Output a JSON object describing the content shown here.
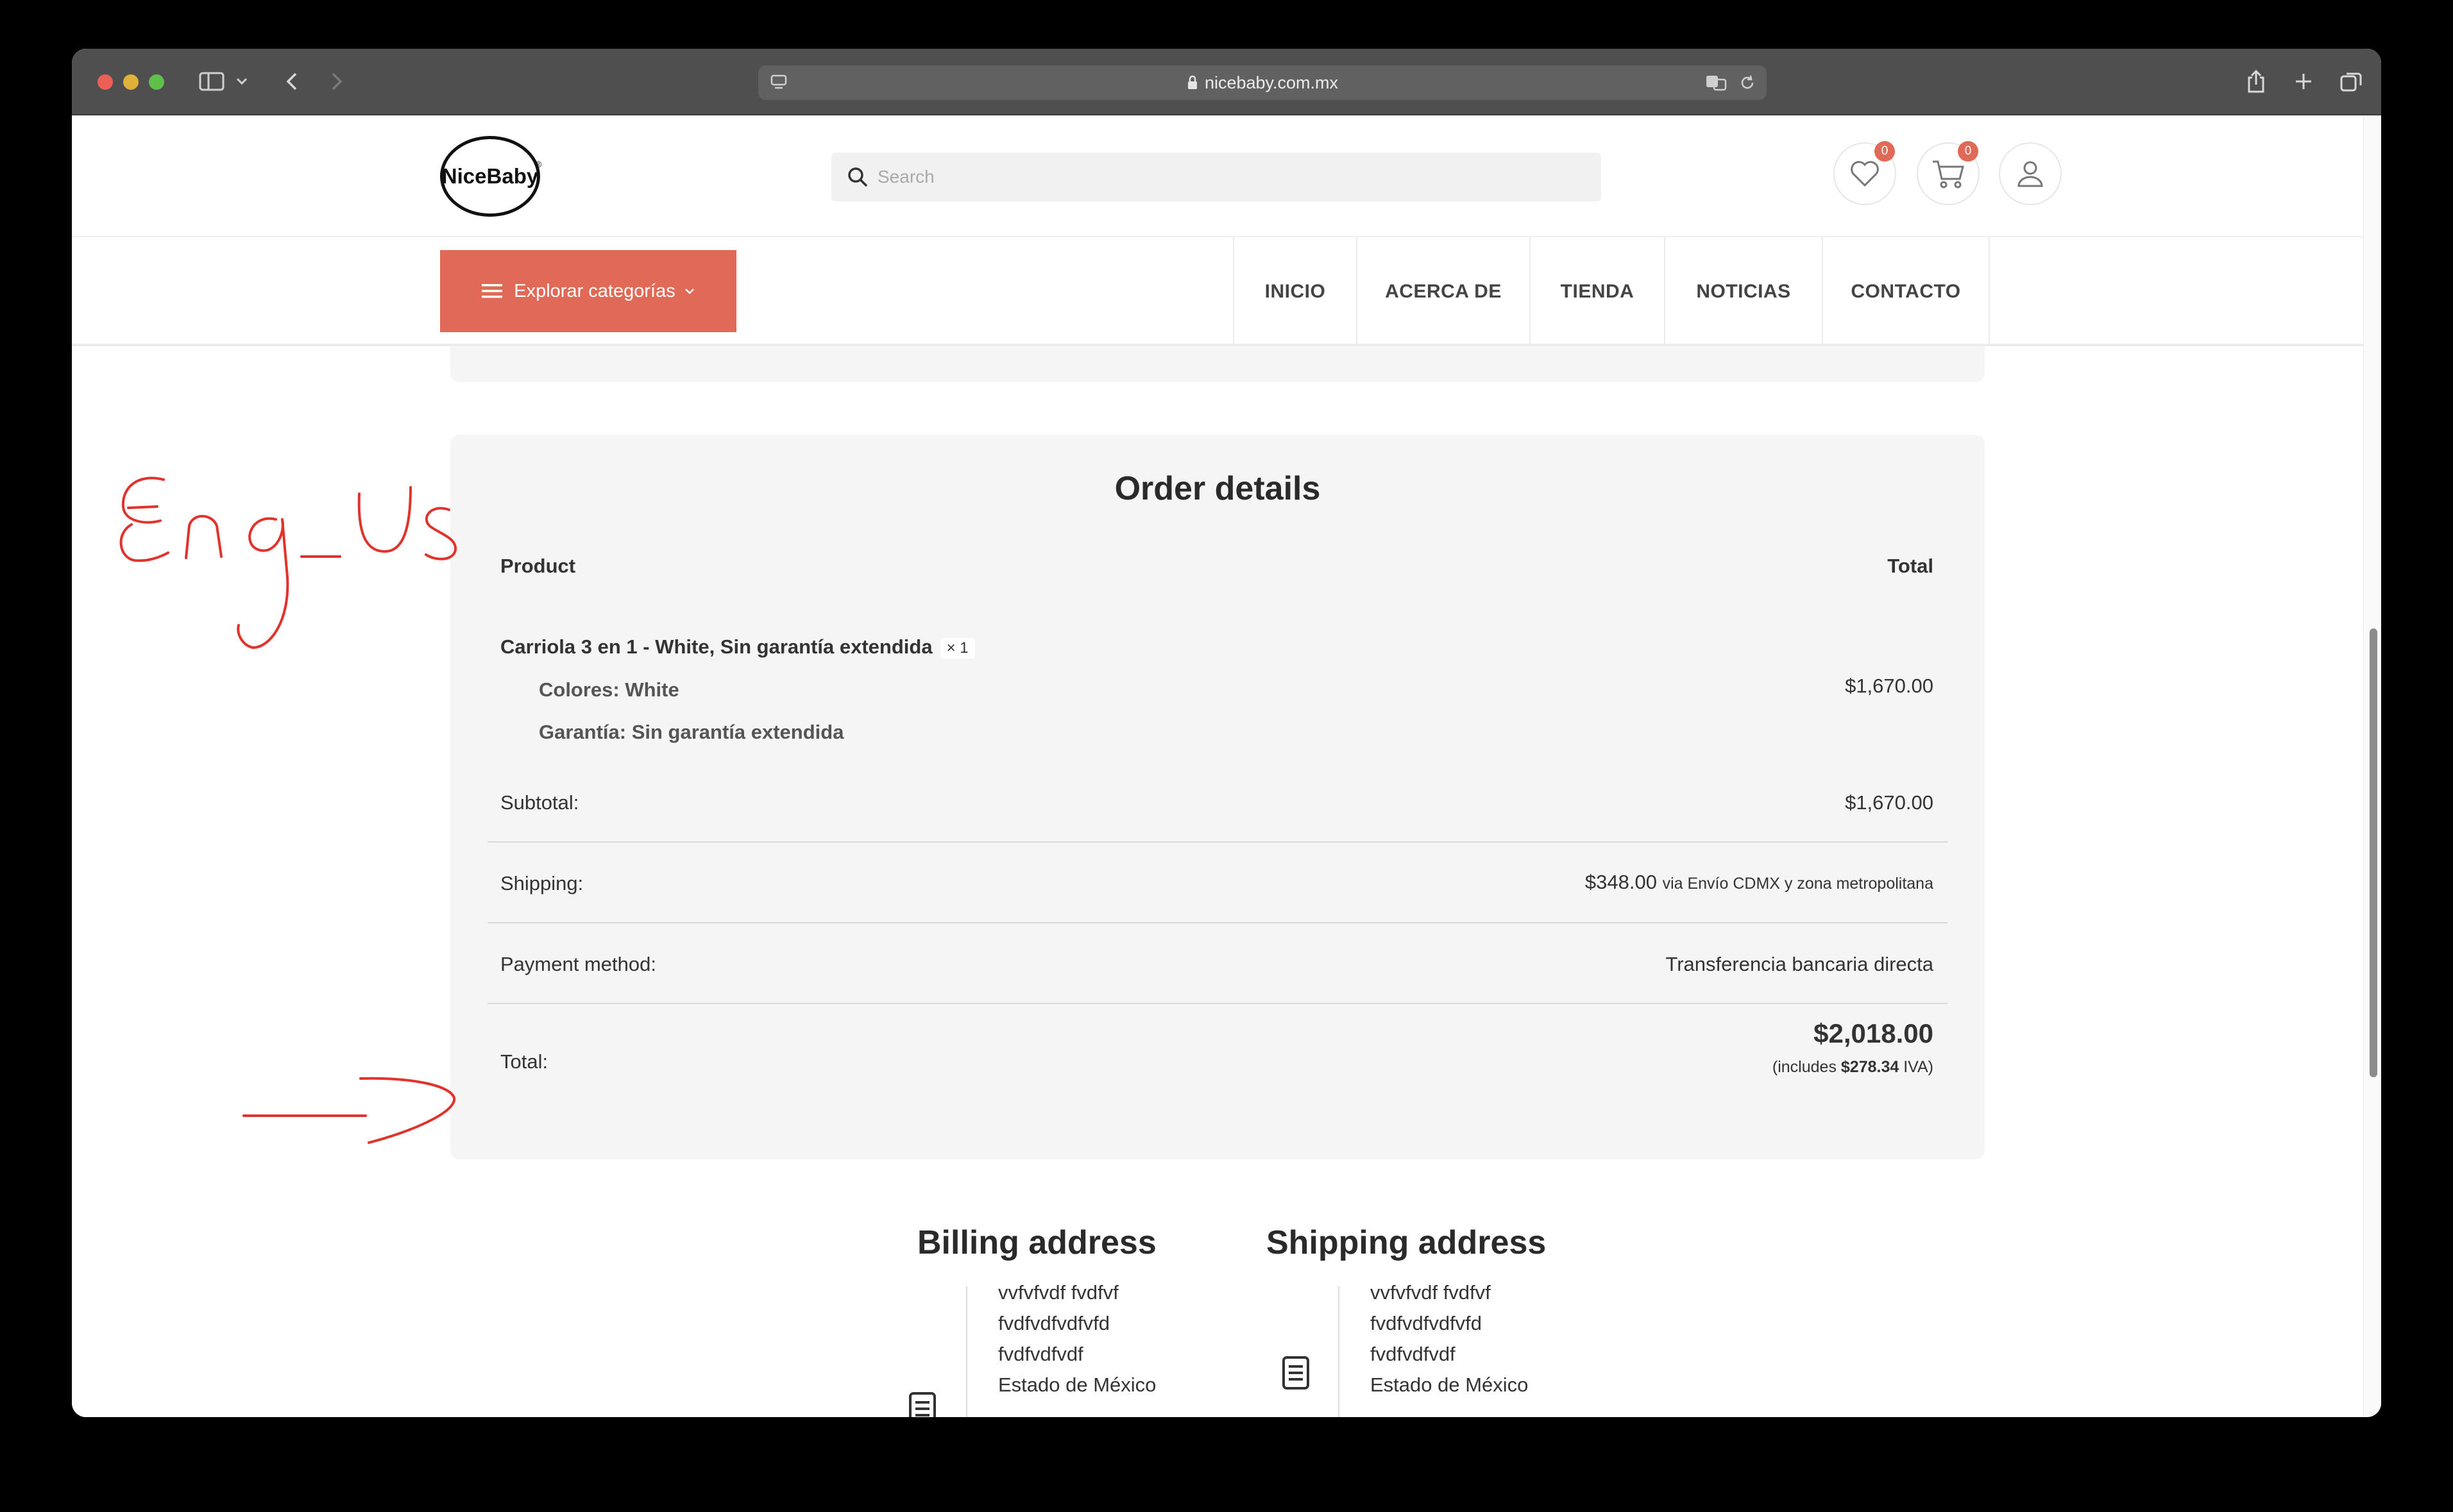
{
  "browser": {
    "url": "nicebaby.com.mx"
  },
  "header": {
    "logo_text": "NiceBaby",
    "logo_reg": "®",
    "search_placeholder": "Search",
    "wishlist_count": "0",
    "cart_count": "0"
  },
  "nav": {
    "categories_label": "Explorar categorías",
    "items": [
      "INICIO",
      "ACERCA DE",
      "TIENDA",
      "NOTICIAS",
      "CONTACTO"
    ]
  },
  "order": {
    "title": "Order details",
    "col_product": "Product",
    "col_total": "Total",
    "item": {
      "name": "Carriola 3 en 1 - White, Sin garantía extendida",
      "qty": "× 1",
      "meta_1": "Colores: White",
      "meta_2": "Garantía: Sin garantía extendida",
      "price": "$1,670.00"
    },
    "subtotal_label": "Subtotal:",
    "subtotal_value": "$1,670.00",
    "shipping_label": "Shipping:",
    "shipping_value": "$348.00",
    "shipping_via": "via Envío CDMX y zona metropolitana",
    "payment_label": "Payment method:",
    "payment_value": "Transferencia bancaria directa",
    "total_label": "Total:",
    "total_value": "$2,018.00",
    "tax_prefix": "(includes",
    "tax_amount": "$278.34",
    "tax_suffix": "IVA)"
  },
  "billing": {
    "title": "Billing address",
    "lines": [
      "vvfvfvdf fvdfvf",
      "fvdfvdfvdfvfd",
      "fvdfvdfvdf",
      "Estado de México"
    ]
  },
  "shipping_address": {
    "title": "Shipping address",
    "lines": [
      "vvfvfvdf fvdfvf",
      "fvdfvdfvdfvfd",
      "fvdfvdfvdf",
      "Estado de México"
    ]
  },
  "annotation": {
    "handwritten_text": "Eng_Us"
  },
  "colors": {
    "accent": "#e06a57",
    "annotation": "#e0332b",
    "card_bg": "#f5f5f5"
  }
}
